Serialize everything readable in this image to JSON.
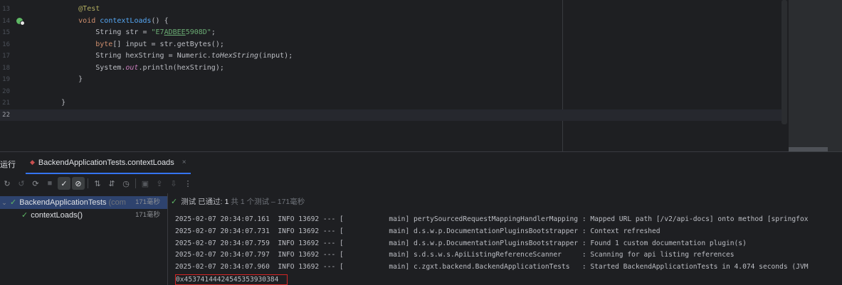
{
  "editor": {
    "lines": [
      {
        "num": "13",
        "segments": [
          {
            "cls": "ann",
            "text": "        @Test"
          }
        ]
      },
      {
        "num": "14",
        "gutter_icon": "run-test-icon",
        "segments": [
          {
            "cls": "kw",
            "text": "        void "
          },
          {
            "cls": "fn",
            "text": "contextLoads"
          },
          {
            "cls": "",
            "text": "() {"
          }
        ]
      },
      {
        "num": "15",
        "segments": [
          {
            "cls": "",
            "text": "            String str = "
          },
          {
            "cls": "str",
            "text": "\"E7"
          },
          {
            "cls": "str ul",
            "text": "ADBEE"
          },
          {
            "cls": "str",
            "text": "5908D\""
          },
          {
            "cls": "",
            "text": ";"
          }
        ]
      },
      {
        "num": "16",
        "segments": [
          {
            "cls": "kw",
            "text": "            byte"
          },
          {
            "cls": "",
            "text": "[] input = str.getBytes();"
          }
        ]
      },
      {
        "num": "17",
        "segments": [
          {
            "cls": "",
            "text": "            String hexString = Numeric."
          },
          {
            "cls": "ital",
            "text": "toHexString"
          },
          {
            "cls": "",
            "text": "(input);"
          }
        ]
      },
      {
        "num": "18",
        "segments": [
          {
            "cls": "",
            "text": "            System."
          },
          {
            "cls": "static",
            "text": "out"
          },
          {
            "cls": "",
            "text": ".println(hexString);"
          }
        ]
      },
      {
        "num": "19",
        "segments": [
          {
            "cls": "",
            "text": "        }"
          }
        ]
      },
      {
        "num": "20",
        "segments": [
          {
            "cls": "",
            "text": ""
          }
        ]
      },
      {
        "num": "21",
        "segments": [
          {
            "cls": "",
            "text": "    }"
          }
        ]
      },
      {
        "num": "22",
        "current": true,
        "segments": [
          {
            "cls": "",
            "text": ""
          }
        ]
      }
    ]
  },
  "run": {
    "title": "运行",
    "tab": {
      "label": "BackendApplicationTests.contextLoads",
      "icon": "test-run-icon",
      "close": "×"
    },
    "toolbar": [
      "rerun-icon",
      "rerun-failed-icon",
      "toggle-auto-test-icon",
      "stop-icon",
      "show-passed-icon",
      "show-ignored-icon",
      "sort-alpha-icon",
      "sort-duration-icon",
      "history-icon",
      "screenshot-icon",
      "export-icon",
      "import-icon",
      "more-icon"
    ],
    "tree": [
      {
        "name": "BackendApplicationTests",
        "pkg": "(com",
        "time": "171毫秒",
        "expanded": true
      },
      {
        "name": "contextLoads()",
        "pkg": "",
        "time": "171毫秒"
      }
    ],
    "status": {
      "prefix": "测试 已通过:",
      "count": "1",
      "suffix": "共 1 个测试 – 171毫秒"
    },
    "console": [
      "2025-02-07 20:34:07.161  INFO 13692 --- [           main] pertySourcedRequestMappingHandlerMapping : Mapped URL path [/v2/api-docs] onto method [springfox",
      "2025-02-07 20:34:07.731  INFO 13692 --- [           main] d.s.w.p.DocumentationPluginsBootstrapper : Context refreshed",
      "2025-02-07 20:34:07.759  INFO 13692 --- [           main] d.s.w.p.DocumentationPluginsBootstrapper : Found 1 custom documentation plugin(s)",
      "2025-02-07 20:34:07.797  INFO 13692 --- [           main] s.d.s.w.s.ApiListingReferenceScanner     : Scanning for api listing references",
      "2025-02-07 20:34:07.960  INFO 13692 --- [           main] c.zgxt.backend.BackendApplicationTests   : Started BackendApplicationTests in 4.074 seconds (JVM"
    ],
    "result": "0x45374144424545353930384",
    "colors": {
      "pass": "#5fb865",
      "highlight_box": "#d42525",
      "tab_underline": "#3574f0"
    }
  }
}
